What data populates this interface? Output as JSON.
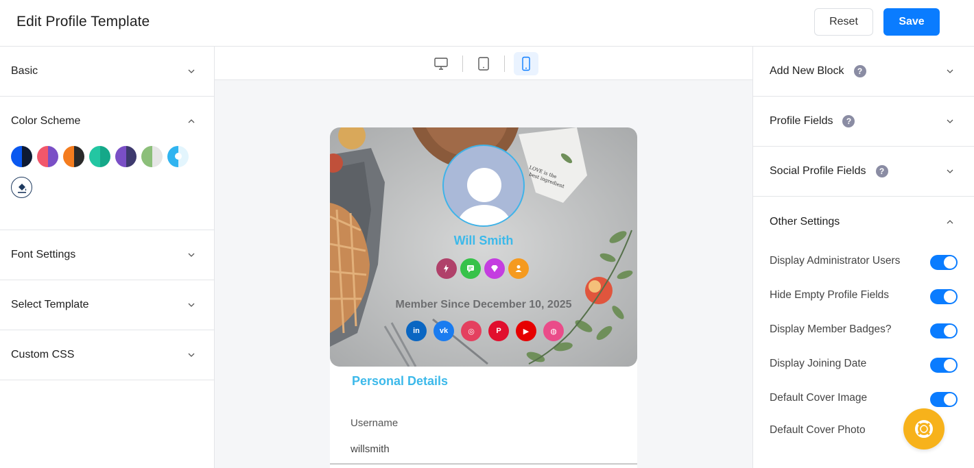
{
  "header": {
    "title": "Edit Profile Template",
    "reset_label": "Reset",
    "save_label": "Save"
  },
  "left_sidebar": {
    "sections": [
      {
        "label": "Basic",
        "expanded": false
      },
      {
        "label": "Color Scheme",
        "expanded": true
      },
      {
        "label": "Font Settings",
        "expanded": false
      },
      {
        "label": "Select Template",
        "expanded": false
      },
      {
        "label": "Custom CSS",
        "expanded": false
      }
    ],
    "color_schemes": [
      {
        "left": "#0a58f0",
        "right": "#0e1a33"
      },
      {
        "left": "#f2576b",
        "right": "#7a4fc6"
      },
      {
        "left": "#f47c1e",
        "right": "#2a2a2a"
      },
      {
        "left": "#23c6a2",
        "right": "#15a889"
      },
      {
        "left": "#7a4fc6",
        "right": "#3e3a6e"
      },
      {
        "left": "#8cbf7a",
        "right": "#e6e6e6"
      },
      {
        "left": "#30b4f0",
        "right": "#e3f5fd"
      }
    ]
  },
  "device_bar": {
    "devices": [
      "desktop-icon",
      "tablet-icon",
      "mobile-icon"
    ],
    "active": "mobile-icon"
  },
  "profile": {
    "name": "Will Smith",
    "badges": [
      {
        "icon": "bolt-icon",
        "color": "#b0416a"
      },
      {
        "icon": "chat-icon",
        "color": "#37c24a"
      },
      {
        "icon": "diamond-icon",
        "color": "#c43de0"
      },
      {
        "icon": "user-icon",
        "color": "#f59a1f"
      }
    ],
    "member_since": "Member Since December 10, 2025",
    "socials": [
      {
        "icon": "linkedin-icon",
        "color": "#0a66c2",
        "glyph": "in"
      },
      {
        "icon": "vk-icon",
        "color": "#1a7cf0",
        "glyph": "vk"
      },
      {
        "icon": "instagram-icon",
        "color": "#e4405f",
        "glyph": "◎"
      },
      {
        "icon": "pinterest-icon",
        "color": "#e10f2e",
        "glyph": "P"
      },
      {
        "icon": "youtube-icon",
        "color": "#e60000",
        "glyph": "▶"
      },
      {
        "icon": "dribbble-icon",
        "color": "#ea4c89",
        "glyph": "◍"
      }
    ],
    "personal_details_title": "Personal Details",
    "fields": [
      {
        "label": "Username",
        "value": "willsmith"
      }
    ]
  },
  "right_sidebar": {
    "sections": [
      {
        "label": "Add New Block",
        "help": "?"
      },
      {
        "label": "Profile Fields",
        "help": "?"
      },
      {
        "label": "Social Profile Fields",
        "help": "?"
      }
    ],
    "other_settings": {
      "title": "Other Settings",
      "options": [
        {
          "label": "Display Administrator Users",
          "on": true
        },
        {
          "label": "Hide Empty Profile Fields",
          "on": true
        },
        {
          "label": "Display Member Badges?",
          "on": true
        },
        {
          "label": "Display Joining Date",
          "on": true
        },
        {
          "label": "Default Cover Image",
          "on": true
        }
      ],
      "extra_label": "Default Cover Photo"
    }
  },
  "colors": {
    "accent": "#0a7cff",
    "profile_accent": "#3cb9ea",
    "fab": "#f7b21b"
  }
}
